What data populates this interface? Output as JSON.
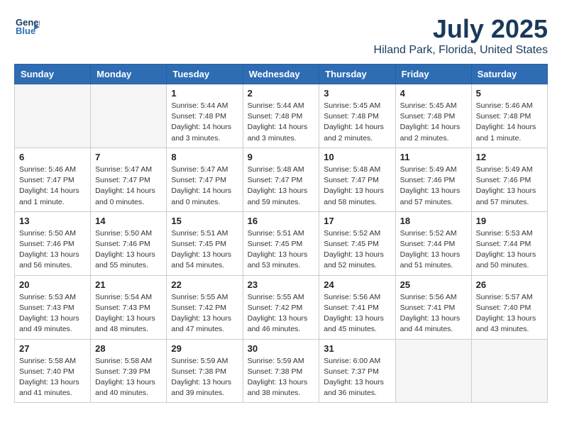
{
  "header": {
    "logo_line1": "General",
    "logo_line2": "Blue",
    "title": "July 2025",
    "subtitle": "Hiland Park, Florida, United States"
  },
  "days_of_week": [
    "Sunday",
    "Monday",
    "Tuesday",
    "Wednesday",
    "Thursday",
    "Friday",
    "Saturday"
  ],
  "weeks": [
    [
      {
        "day": "",
        "info": ""
      },
      {
        "day": "",
        "info": ""
      },
      {
        "day": "1",
        "info": "Sunrise: 5:44 AM\nSunset: 7:48 PM\nDaylight: 14 hours\nand 3 minutes."
      },
      {
        "day": "2",
        "info": "Sunrise: 5:44 AM\nSunset: 7:48 PM\nDaylight: 14 hours\nand 3 minutes."
      },
      {
        "day": "3",
        "info": "Sunrise: 5:45 AM\nSunset: 7:48 PM\nDaylight: 14 hours\nand 2 minutes."
      },
      {
        "day": "4",
        "info": "Sunrise: 5:45 AM\nSunset: 7:48 PM\nDaylight: 14 hours\nand 2 minutes."
      },
      {
        "day": "5",
        "info": "Sunrise: 5:46 AM\nSunset: 7:48 PM\nDaylight: 14 hours\nand 1 minute."
      }
    ],
    [
      {
        "day": "6",
        "info": "Sunrise: 5:46 AM\nSunset: 7:47 PM\nDaylight: 14 hours\nand 1 minute."
      },
      {
        "day": "7",
        "info": "Sunrise: 5:47 AM\nSunset: 7:47 PM\nDaylight: 14 hours\nand 0 minutes."
      },
      {
        "day": "8",
        "info": "Sunrise: 5:47 AM\nSunset: 7:47 PM\nDaylight: 14 hours\nand 0 minutes."
      },
      {
        "day": "9",
        "info": "Sunrise: 5:48 AM\nSunset: 7:47 PM\nDaylight: 13 hours\nand 59 minutes."
      },
      {
        "day": "10",
        "info": "Sunrise: 5:48 AM\nSunset: 7:47 PM\nDaylight: 13 hours\nand 58 minutes."
      },
      {
        "day": "11",
        "info": "Sunrise: 5:49 AM\nSunset: 7:46 PM\nDaylight: 13 hours\nand 57 minutes."
      },
      {
        "day": "12",
        "info": "Sunrise: 5:49 AM\nSunset: 7:46 PM\nDaylight: 13 hours\nand 57 minutes."
      }
    ],
    [
      {
        "day": "13",
        "info": "Sunrise: 5:50 AM\nSunset: 7:46 PM\nDaylight: 13 hours\nand 56 minutes."
      },
      {
        "day": "14",
        "info": "Sunrise: 5:50 AM\nSunset: 7:46 PM\nDaylight: 13 hours\nand 55 minutes."
      },
      {
        "day": "15",
        "info": "Sunrise: 5:51 AM\nSunset: 7:45 PM\nDaylight: 13 hours\nand 54 minutes."
      },
      {
        "day": "16",
        "info": "Sunrise: 5:51 AM\nSunset: 7:45 PM\nDaylight: 13 hours\nand 53 minutes."
      },
      {
        "day": "17",
        "info": "Sunrise: 5:52 AM\nSunset: 7:45 PM\nDaylight: 13 hours\nand 52 minutes."
      },
      {
        "day": "18",
        "info": "Sunrise: 5:52 AM\nSunset: 7:44 PM\nDaylight: 13 hours\nand 51 minutes."
      },
      {
        "day": "19",
        "info": "Sunrise: 5:53 AM\nSunset: 7:44 PM\nDaylight: 13 hours\nand 50 minutes."
      }
    ],
    [
      {
        "day": "20",
        "info": "Sunrise: 5:53 AM\nSunset: 7:43 PM\nDaylight: 13 hours\nand 49 minutes."
      },
      {
        "day": "21",
        "info": "Sunrise: 5:54 AM\nSunset: 7:43 PM\nDaylight: 13 hours\nand 48 minutes."
      },
      {
        "day": "22",
        "info": "Sunrise: 5:55 AM\nSunset: 7:42 PM\nDaylight: 13 hours\nand 47 minutes."
      },
      {
        "day": "23",
        "info": "Sunrise: 5:55 AM\nSunset: 7:42 PM\nDaylight: 13 hours\nand 46 minutes."
      },
      {
        "day": "24",
        "info": "Sunrise: 5:56 AM\nSunset: 7:41 PM\nDaylight: 13 hours\nand 45 minutes."
      },
      {
        "day": "25",
        "info": "Sunrise: 5:56 AM\nSunset: 7:41 PM\nDaylight: 13 hours\nand 44 minutes."
      },
      {
        "day": "26",
        "info": "Sunrise: 5:57 AM\nSunset: 7:40 PM\nDaylight: 13 hours\nand 43 minutes."
      }
    ],
    [
      {
        "day": "27",
        "info": "Sunrise: 5:58 AM\nSunset: 7:40 PM\nDaylight: 13 hours\nand 41 minutes."
      },
      {
        "day": "28",
        "info": "Sunrise: 5:58 AM\nSunset: 7:39 PM\nDaylight: 13 hours\nand 40 minutes."
      },
      {
        "day": "29",
        "info": "Sunrise: 5:59 AM\nSunset: 7:38 PM\nDaylight: 13 hours\nand 39 minutes."
      },
      {
        "day": "30",
        "info": "Sunrise: 5:59 AM\nSunset: 7:38 PM\nDaylight: 13 hours\nand 38 minutes."
      },
      {
        "day": "31",
        "info": "Sunrise: 6:00 AM\nSunset: 7:37 PM\nDaylight: 13 hours\nand 36 minutes."
      },
      {
        "day": "",
        "info": ""
      },
      {
        "day": "",
        "info": ""
      }
    ]
  ]
}
